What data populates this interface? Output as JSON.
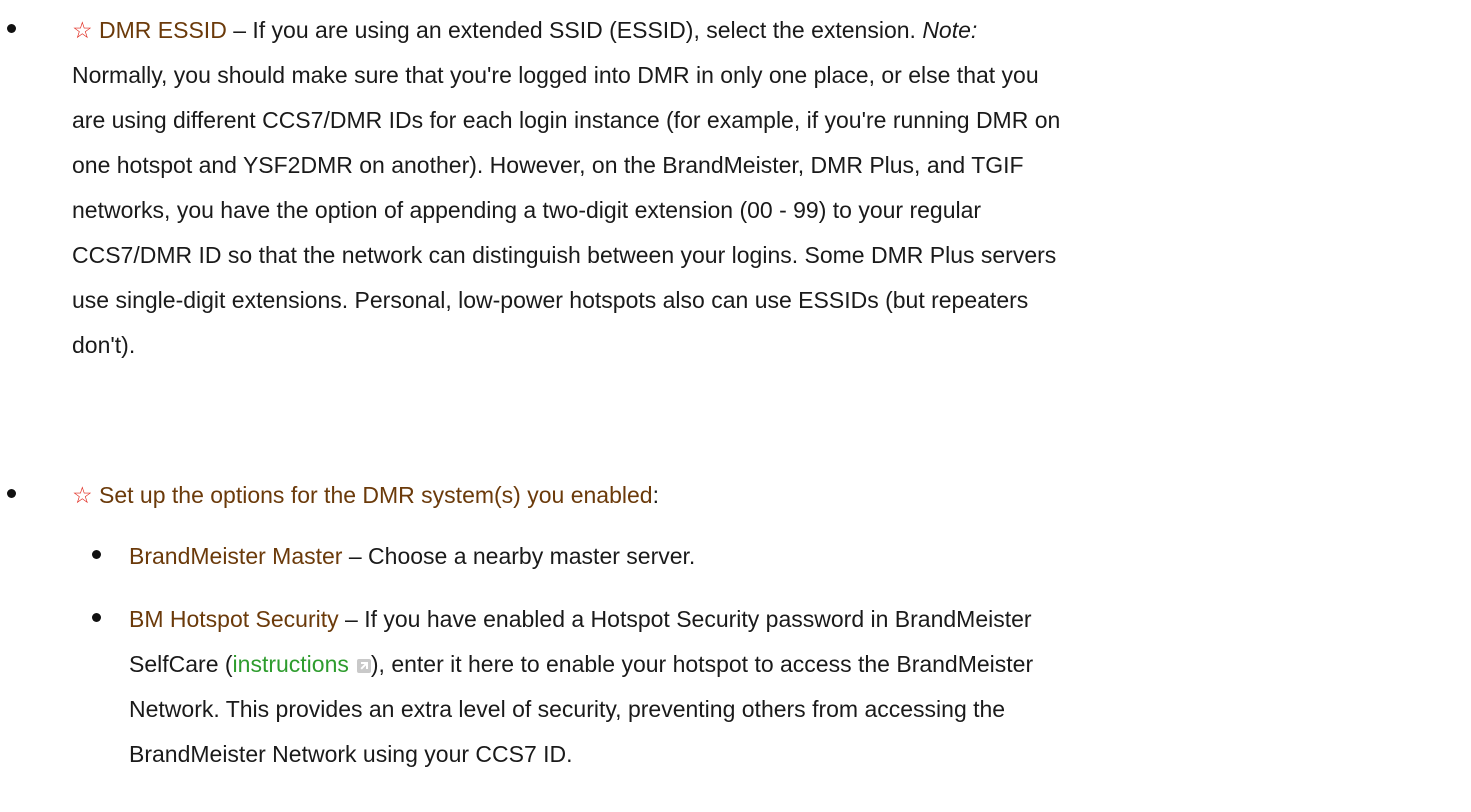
{
  "star_glyph": "☆",
  "colors": {
    "term": "#6b3a0a",
    "star": "#e0261b",
    "link": "#2e9c2e",
    "text": "#1a1a1a"
  },
  "items": [
    {
      "term": "DMR ESSID",
      "dash": " – ",
      "lines": [
        "If you are using an extended SSID (ESSID), select the extension. ",
        "Normally, you should make sure that you're logged into DMR in only one place, or else that you",
        "are using different CCS7/DMR IDs for each login instance (for example, if you're running DMR on",
        "one hotspot and YSF2DMR on another). However, on the BrandMeister, DMR Plus, and TGIF",
        "networks, you have the option of appending a two-digit extension (00 - 99) to your regular",
        "CCS7/DMR ID so that the network can distinguish between your logins. Some DMR Plus servers",
        "use single-digit extensions. Personal, low-power hotspots also can use ESSIDs (but repeaters",
        "don't)."
      ],
      "note_label": "Note:"
    },
    {
      "term": "Set up the options for the DMR system(s) you enabled",
      "suffix": ":"
    }
  ],
  "subitems": [
    {
      "term": "BrandMeister Master",
      "dash": " – ",
      "text": "Choose a nearby master server."
    },
    {
      "term": "BM Hotspot Security",
      "dash": " – ",
      "line1": "If you have enabled a Hotspot Security password in BrandMeister",
      "line2_before": "SelfCare (",
      "link": "instructions",
      "link_icon": "external-link-icon",
      "line2_after": "), enter it here to enable your hotspot to access the BrandMeister",
      "line3": "Network. This provides an extra level of security, preventing others from accessing the",
      "line4": "BrandMeister Network using your CCS7 ID."
    }
  ]
}
